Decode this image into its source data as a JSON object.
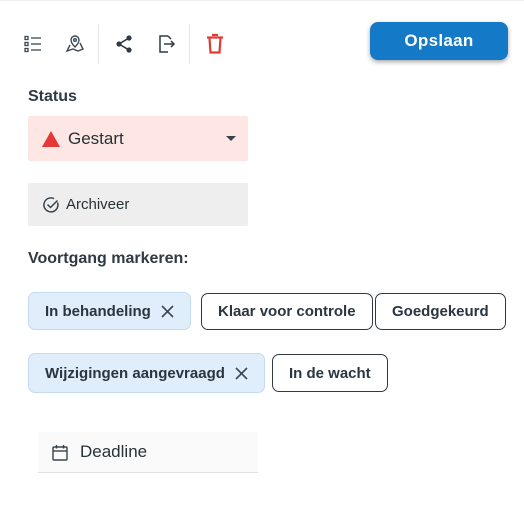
{
  "toolbar": {
    "icons": [
      "checklist-icon",
      "map-pin-icon",
      "share-icon",
      "export-icon",
      "delete-icon"
    ],
    "delete_color": "#e53935"
  },
  "actions": {
    "save_label": "Opslaan",
    "save_color": "#1479c6"
  },
  "status": {
    "label": "Status",
    "selected": "Gestart",
    "selected_icon": "warning-triangle-icon",
    "selected_color": "#e53935",
    "background": "#fde6e4"
  },
  "archive": {
    "label": "Archiveer",
    "icon": "check-circle-icon"
  },
  "progress": {
    "label": "Voortgang markeren:",
    "chips": [
      {
        "label": "In behandeling",
        "selected": true
      },
      {
        "label": "Klaar voor controle",
        "selected": false
      },
      {
        "label": "Goedgekeurd",
        "selected": false
      },
      {
        "label": "Wijzigingen aangevraagd",
        "selected": true
      },
      {
        "label": "In de wacht",
        "selected": false
      }
    ]
  },
  "deadline": {
    "label": "Deadline",
    "icon": "calendar-icon"
  }
}
